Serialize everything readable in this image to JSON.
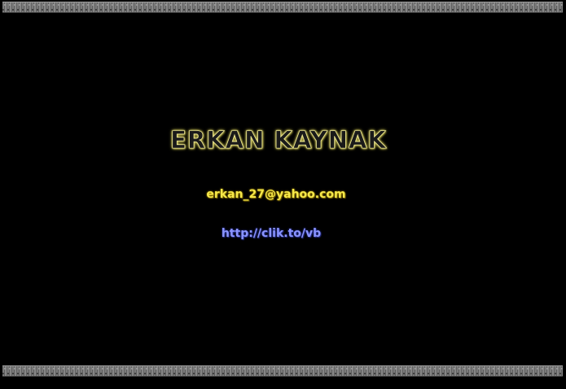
{
  "page": {
    "title": "ERKAN KAYNAK",
    "email": "erkan_27@yahoo.com",
    "url": "http://clik.to/vb"
  },
  "colors": {
    "background": "#000000",
    "title_glow": "#e8e070",
    "email": "#f5e84a",
    "url": "#8a94ff",
    "stripe": "#6e6e6e"
  }
}
